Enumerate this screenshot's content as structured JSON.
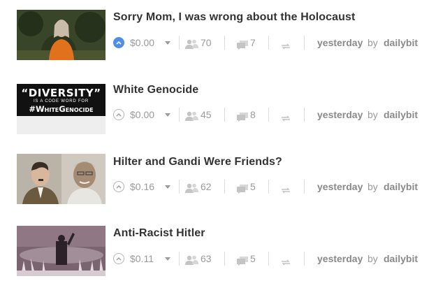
{
  "posts": [
    {
      "title": "Sorry Mom, I was wrong about the Holocaust",
      "payout": "$0.00",
      "voters": "70",
      "comments": "7",
      "time": "yesterday",
      "by": "by",
      "author": "dailybit",
      "voted": true
    },
    {
      "title": "White Genocide",
      "thumb_text": {
        "line1": "“DIVERSITY”",
        "line2": "IS A CODE WORD FOR",
        "line3": "#WhiteGenocide"
      },
      "payout": "$0.00",
      "voters": "45",
      "comments": "8",
      "time": "yesterday",
      "by": "by",
      "author": "dailybit",
      "voted": false
    },
    {
      "title": "Hilter and Gandi Were Friends?",
      "payout": "$0.16",
      "voters": "62",
      "comments": "5",
      "time": "yesterday",
      "by": "by",
      "author": "dailybit",
      "voted": false
    },
    {
      "title": "Anti-Racist Hitler",
      "payout": "$0.11",
      "voters": "63",
      "comments": "5",
      "time": "yesterday",
      "by": "by",
      "author": "dailybit",
      "voted": false
    }
  ],
  "icons": {
    "upvote": "chevron-up-icon",
    "payout_menu": "caret-down-icon",
    "voters": "users-icon",
    "comments": "comments-icon",
    "reblog": "reblog-icon"
  },
  "colors": {
    "vote_active": "#4f8fe6",
    "muted": "#9a9a9a",
    "title": "#333333"
  }
}
